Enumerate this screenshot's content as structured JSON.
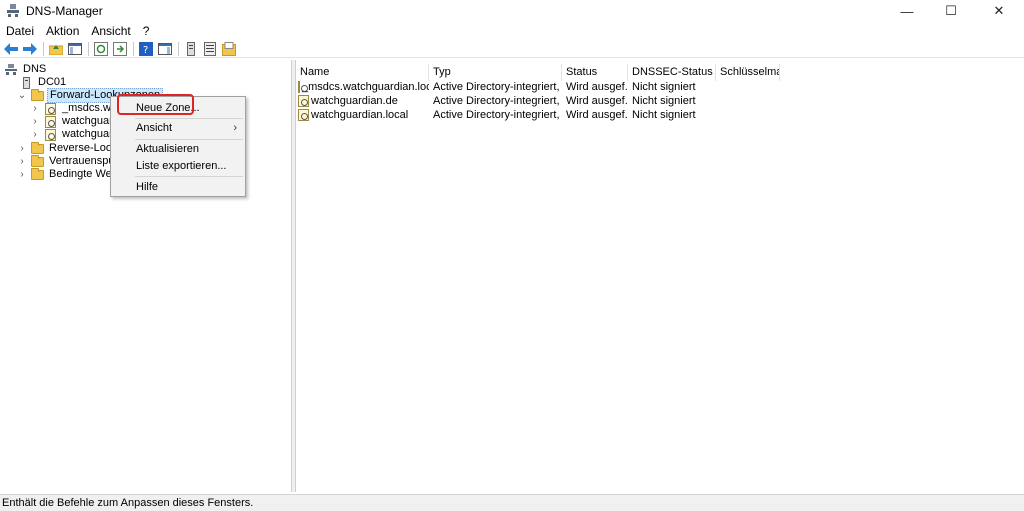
{
  "window": {
    "title": "DNS-Manager",
    "minimize": "—",
    "maximize": "☐",
    "close": "✕"
  },
  "menu": [
    "Datei",
    "Aktion",
    "Ansicht",
    "?"
  ],
  "tree": {
    "root": "DNS",
    "server": "DC01",
    "forward": "Forward-Lookupzonen",
    "zone1": "_msdcs.watc",
    "zone2": "watchguardi",
    "zone3": "watchguardi",
    "reverse": "Reverse-Lookup",
    "trust": "Vertrauenspunkt",
    "conditional": "Bedingte Weiter"
  },
  "context_menu": {
    "new_zone": "Neue Zone...",
    "view": "Ansicht",
    "view_arrow": "›",
    "refresh": "Aktualisieren",
    "export": "Liste exportieren...",
    "help": "Hilfe"
  },
  "list": {
    "columns": [
      "Name",
      "Typ",
      "Status",
      "DNSSEC-Status",
      "Schlüsselma..."
    ],
    "rows": [
      [
        "_msdcs.watchguardian.local",
        "Active Directory-integriert, pri...",
        "Wird ausgef...",
        "Nicht signiert"
      ],
      [
        "watchguardian.de",
        "Active Directory-integriert, pri...",
        "Wird ausgef...",
        "Nicht signiert"
      ],
      [
        "watchguardian.local",
        "Active Directory-integriert, pri...",
        "Wird ausgef...",
        "Nicht signiert"
      ]
    ]
  },
  "status_text": "Enthält die Befehle zum Anpassen dieses Fensters."
}
